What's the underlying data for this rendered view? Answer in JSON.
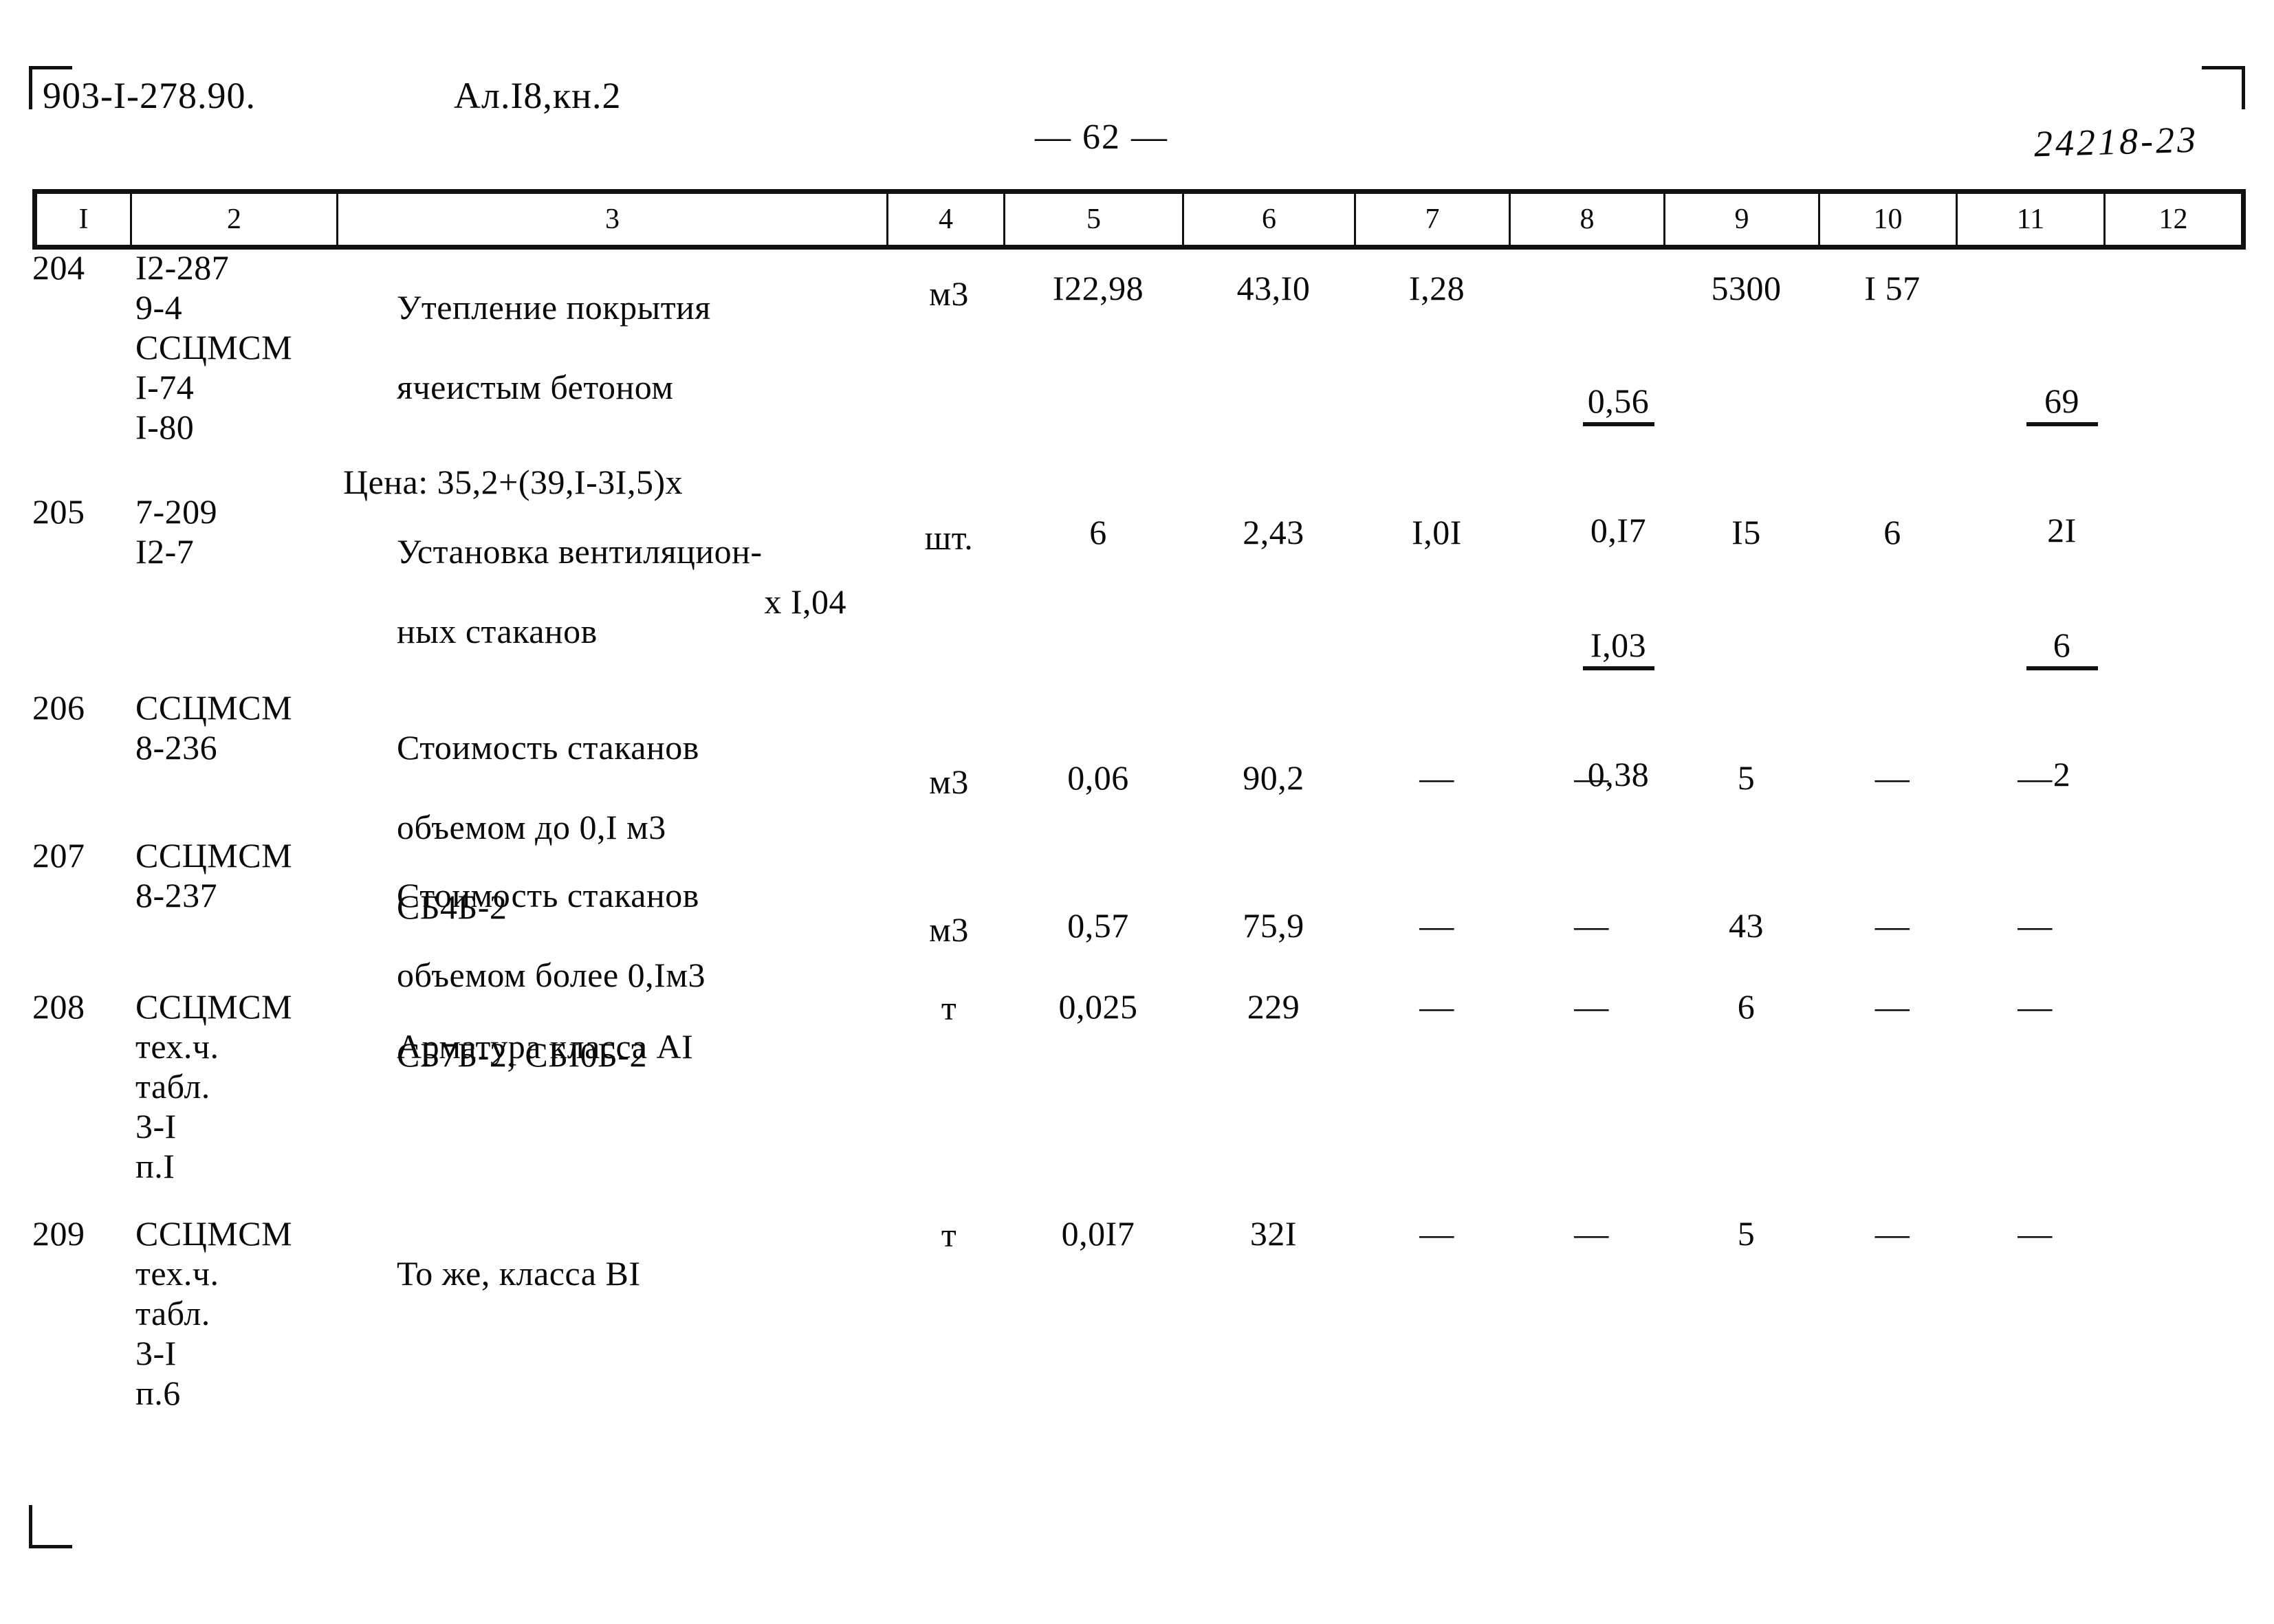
{
  "header": {
    "doc_code": "903-I-278.90.",
    "album": "Ал.I8,кн.2",
    "page_number": "— 62 —",
    "stamp": "24218-23"
  },
  "table": {
    "column_headers": [
      "I",
      "2",
      "3",
      "4",
      "5",
      "6",
      "7",
      "8",
      "9",
      "10",
      "11",
      "12"
    ],
    "rows": [
      {
        "no": "204",
        "code": "I2-287\n9-4\nССЦМСМ\nI-74\nI-80",
        "desc_line1": "Утепление покрытия",
        "desc_line2": "ячеистым бетоном",
        "desc_line3": "Цена: 35,2+(39,I-3I,5)х",
        "desc_line4": "х I,04",
        "unit": "м3",
        "c5": "I22,98",
        "c6": "43,I0",
        "c7": "I,28",
        "c8_top": "0,56",
        "c8_bot": "0,I7",
        "c9": "5300",
        "c10": "I 57",
        "c11_top": "69",
        "c11_bot": "2I",
        "c12": ""
      },
      {
        "no": "205",
        "code": "7-209\nI2-7",
        "desc_line1": "Установка вентиляцион-",
        "desc_line2": "ных стаканов",
        "desc_line3": "",
        "desc_line4": "",
        "unit": "шт.",
        "c5": "6",
        "c6": "2,43",
        "c7": "I,0I",
        "c8_top": "I,03",
        "c8_bot": "0,38",
        "c9": "I5",
        "c10": "6",
        "c11_top": "6",
        "c11_bot": "2",
        "c12": ""
      },
      {
        "no": "206",
        "code": "ССЦМСМ\n8-236",
        "desc_line1": "Стоимость стаканов",
        "desc_line2": "объемом до 0,I м3",
        "desc_line3": "СБ4Б-2",
        "desc_line4": "",
        "unit": "м3",
        "c5": "0,06",
        "c6": "90,2",
        "c7": "—",
        "c8_top": "—",
        "c8_bot": "",
        "c9": "5",
        "c10": "—",
        "c11_top": "—",
        "c11_bot": "",
        "c12": ""
      },
      {
        "no": "207",
        "code": "ССЦМСМ\n8-237",
        "desc_line1": "Стоимость стаканов",
        "desc_line2": "объемом более 0,Iм3",
        "desc_line3": "СБ7Б-2, СБI0Б-2",
        "desc_line4": "",
        "unit": "м3",
        "c5": "0,57",
        "c6": "75,9",
        "c7": "—",
        "c8_top": "—",
        "c8_bot": "",
        "c9": "43",
        "c10": "—",
        "c11_top": "—",
        "c11_bot": "",
        "c12": ""
      },
      {
        "no": "208",
        "code": "ССЦМСМ\nтех.ч.\nтабл.\n3-I\nп.I",
        "desc_line1": "Арматура класса АI",
        "desc_line2": "",
        "desc_line3": "",
        "desc_line4": "",
        "unit": "т",
        "c5": "0,025",
        "c6": "229",
        "c7": "—",
        "c8_top": "—",
        "c8_bot": "",
        "c9": "6",
        "c10": "—",
        "c11_top": "—",
        "c11_bot": "",
        "c12": ""
      },
      {
        "no": "209",
        "code": "ССЦМСМ\nтех.ч.\nтабл.\n3-I\nп.6",
        "desc_line1": "То же, класса ВI",
        "desc_line2": "",
        "desc_line3": "",
        "desc_line4": "",
        "unit": "т",
        "c5": "0,0I7",
        "c6": "32I",
        "c7": "—",
        "c8_top": "—",
        "c8_bot": "",
        "c9": "5",
        "c10": "—",
        "c11_top": "—",
        "c11_bot": "",
        "c12": ""
      }
    ]
  }
}
